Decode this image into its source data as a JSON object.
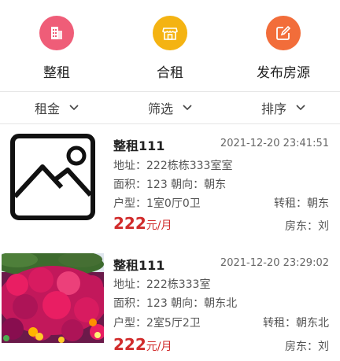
{
  "nav": [
    {
      "label": "整租",
      "icon": "building-icon",
      "color": "#ef5d78"
    },
    {
      "label": "合租",
      "icon": "shop-icon",
      "color": "#f4b312"
    },
    {
      "label": "发布房源",
      "icon": "edit-icon",
      "color": "#f26d3a"
    }
  ],
  "filters": [
    {
      "label": "租金"
    },
    {
      "label": "筛选"
    },
    {
      "label": "排序"
    }
  ],
  "listings": [
    {
      "title": "整租111",
      "time": "2021-12-20 23:41:51",
      "address": "地址：222栋栋333室室",
      "area_orientation": "面积：123   朝向：朝东",
      "layout": "户型：1室0厅0卫",
      "sublet": "转租：朝东",
      "price": "222",
      "unit": "元/月",
      "landlord": "房东：刘",
      "image": "placeholder-image-icon"
    },
    {
      "title": "整租111",
      "time": "2021-12-20 23:29:02",
      "address": "地址：222栋333室",
      "area_orientation": "面积：123   朝向：朝东北",
      "layout": "户型：2室5厅2卫",
      "sublet": "转租：朝东北",
      "price": "222",
      "unit": "元/月",
      "landlord": "房东：刘",
      "image": "flowers-photo"
    }
  ]
}
